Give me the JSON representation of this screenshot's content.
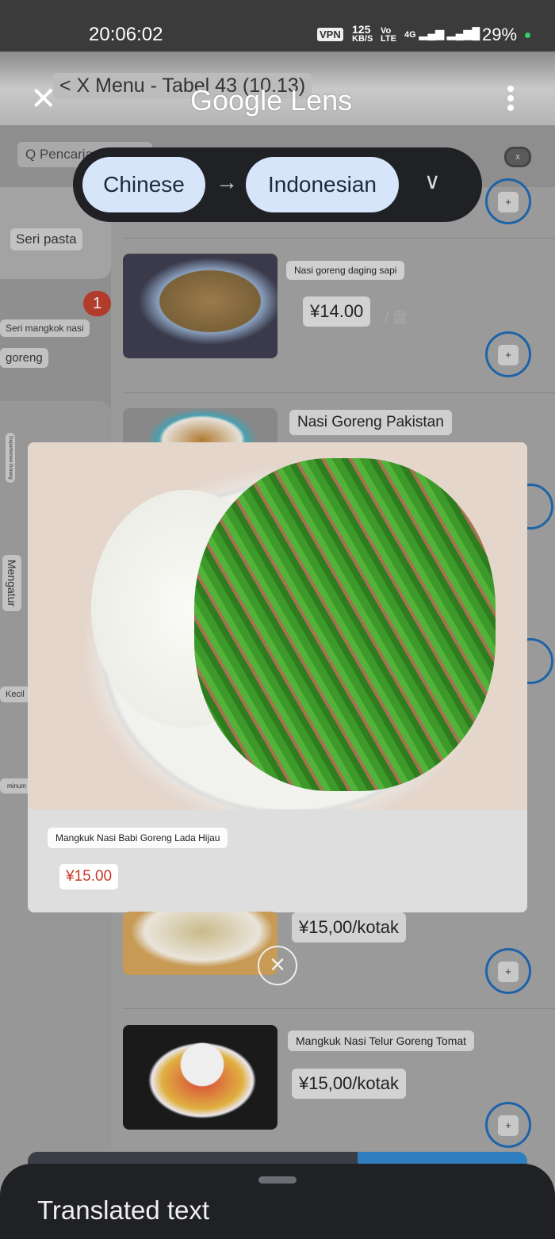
{
  "status_bar": {
    "time": "20:06:02",
    "vpn": "VPN",
    "speed_value": "125",
    "speed_unit": "KB/S",
    "network": "Vo LTE",
    "network_type": "4G",
    "battery": "29%"
  },
  "header": {
    "underlying_title": "< X Menu - Tabel 43 (10.13)",
    "title": "Google Lens",
    "close_icon": "close-icon",
    "menu_icon": "more-vert-icon"
  },
  "search": {
    "placeholder": "Q Pencarian",
    "clear_label": "x"
  },
  "translate": {
    "source": "Chinese",
    "target": "Indonesian",
    "arrow": "→",
    "chevron": "∨"
  },
  "sidebar": {
    "items": [
      "Seri pasta",
      "Seri mangkok nasi",
      "goreng",
      "Departemen Goreng",
      "Mengatur",
      "Kecil",
      "minum"
    ],
    "badge": "1"
  },
  "menu_items": [
    {
      "name": "Nasi goreng daging sapi",
      "price": "¥14.00",
      "unit": "/ 盘"
    },
    {
      "name": "Nasi Goreng Pakistan"
    },
    {
      "price": "¥15,00/kotak"
    },
    {
      "name": "Mangkuk Nasi Telur Goreng Tomat",
      "price": "¥15,00/kotak"
    }
  ],
  "plus_label": "+",
  "modal": {
    "name": "Mangkuk Nasi Babi Goreng Lada Hijau",
    "price": "¥15.00",
    "close": "×"
  },
  "sheet": {
    "title": "Translated text"
  },
  "colors": {
    "accent": "#1e63a8",
    "price_red": "#c83a2a",
    "chip": "#d6e5fa",
    "sheet": "#1f2124"
  }
}
